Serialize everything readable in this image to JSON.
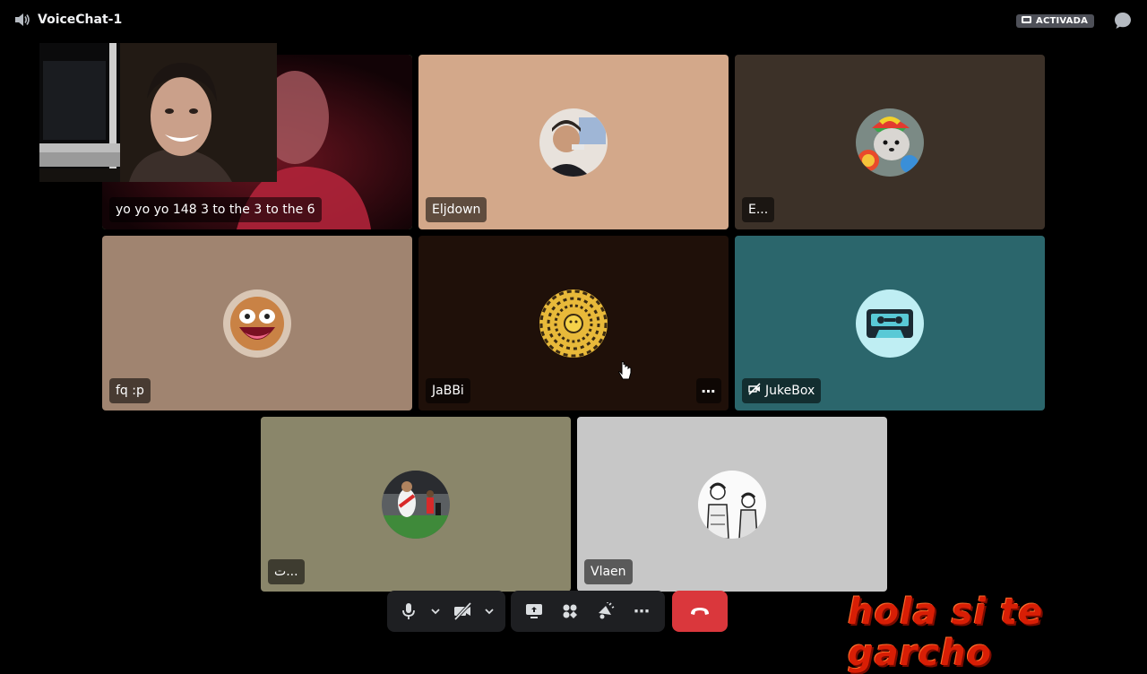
{
  "header": {
    "channel_name": "VoiceChat-1",
    "activity_badge": "ACTIVADA",
    "icons": [
      "speaker-icon",
      "activity-icon",
      "chat-bubble-icon"
    ]
  },
  "tiles": [
    {
      "name": "yo yo yo 148 3 to the 3 to the 6",
      "bg": "#2a0a10",
      "speaking": true,
      "avatar": "camera-video"
    },
    {
      "name": "Eljdown",
      "bg": "#d3a88a",
      "speaking": false,
      "avatar": "person-photo"
    },
    {
      "name": "E...",
      "bg": "#3c3128",
      "speaking": false,
      "avatar": "dog-hat-photo"
    },
    {
      "name": "fq :p",
      "bg": "#a08470",
      "speaking": false,
      "avatar": "awesome-face"
    },
    {
      "name": "JaBBi",
      "bg": "#1f1009",
      "speaking": false,
      "avatar": "spiral-logo",
      "more_label": "⋯"
    },
    {
      "name": "JukeBox",
      "bg": "#2b666c",
      "speaking": false,
      "avatar": "cassette-logo",
      "label_icon": "no-video-icon"
    },
    {
      "name": "ت...",
      "bg": "#8a866a",
      "speaking": false,
      "avatar": "football-photo"
    },
    {
      "name": "Vlaen",
      "bg": "#c7c7c7",
      "speaking": false,
      "avatar": "manga-drawing"
    }
  ],
  "controls": {
    "buttons": [
      "microphone-button",
      "mic-options-button",
      "camera-off-button",
      "camera-options-button",
      "screen-share-button",
      "activities-button",
      "soundboard-button",
      "more-options-button",
      "disconnect-button"
    ],
    "more_label": "⋯"
  },
  "watermark": "hola si te garcho",
  "colors": {
    "speaking_ring": "#3ba55c",
    "hangup": "#da373c",
    "control_bg": "#1e1f22",
    "badge_bg": "#4e5058",
    "watermark": "#d81e05"
  }
}
